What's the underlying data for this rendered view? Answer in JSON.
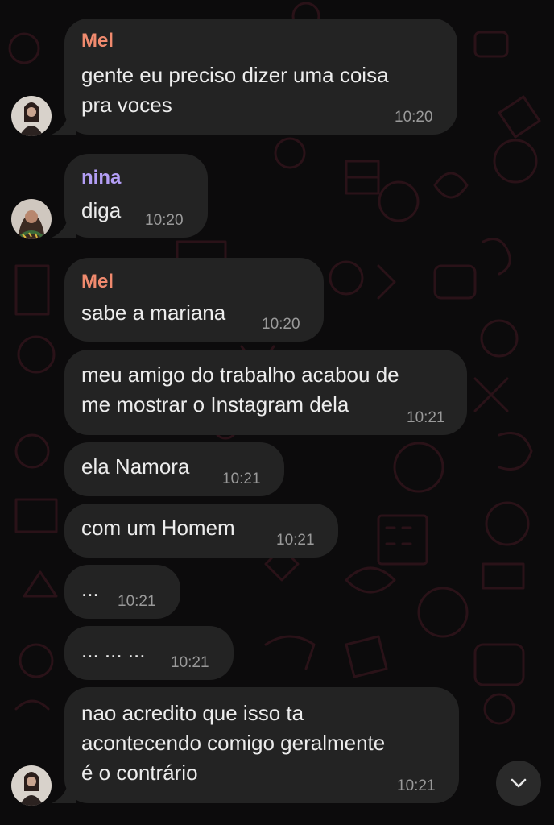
{
  "colors": {
    "background": "#0c0b0c",
    "bubble": "#232323",
    "text": "#ececec",
    "timestamp": "#9a9a9a",
    "sender_mel": "#f08a6e",
    "sender_nina": "#b39ef5",
    "wallpaper_doodle": "#2a1218"
  },
  "messages": [
    {
      "sender": "Mel",
      "lines": "gente eu preciso dizer uma coisa\npra voces",
      "time": "10:20"
    },
    {
      "sender": "nina",
      "lines": "diga",
      "time": "10:20"
    },
    {
      "sender": "Mel",
      "lines": "sabe a mariana",
      "time": "10:20"
    },
    {
      "sender": "",
      "lines": "meu amigo do trabalho acabou de\nme mostrar o Instagram dela",
      "time": "10:21"
    },
    {
      "sender": "",
      "lines": "ela Namora",
      "time": "10:21"
    },
    {
      "sender": "",
      "lines": "com um Homem",
      "time": "10:21"
    },
    {
      "sender": "",
      "lines": "...",
      "time": "10:21"
    },
    {
      "sender": "",
      "lines": "... ... ...",
      "time": "10:21"
    },
    {
      "sender": "",
      "lines": "nao acredito que isso ta\nacontecendo comigo geralmente\né o contrário",
      "time": "10:21"
    }
  ],
  "avatars": [
    {
      "user": "Mel",
      "icon": "profile-photo"
    },
    {
      "user": "nina",
      "icon": "profile-photo"
    },
    {
      "user": "Mel",
      "icon": "profile-photo"
    }
  ],
  "scroll_button": {
    "icon": "chevron-down-icon"
  }
}
